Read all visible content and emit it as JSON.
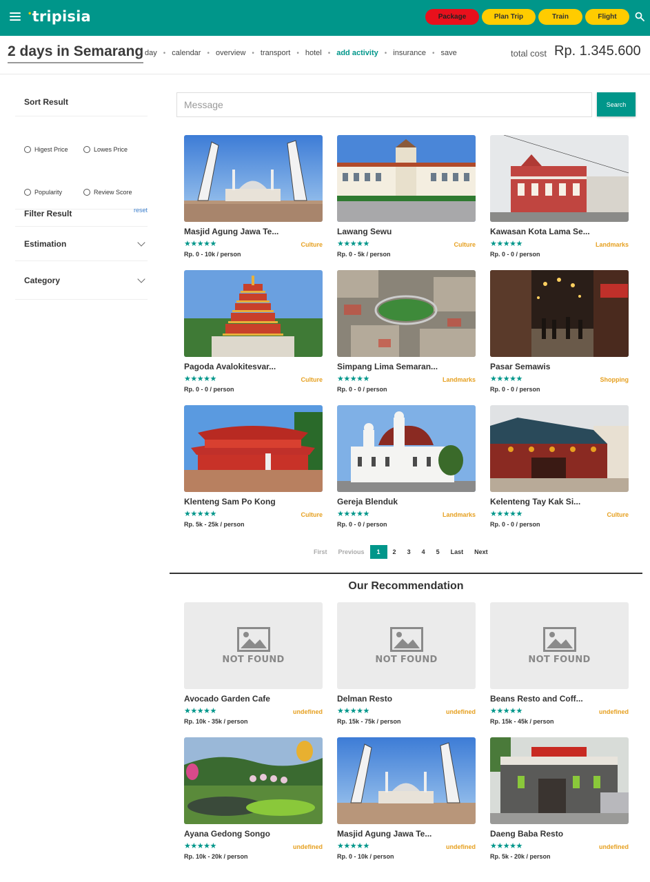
{
  "app": {
    "logo": "tripisia"
  },
  "topnav": {
    "buttons": [
      "Package",
      "Plan Trip",
      "Train",
      "Flight"
    ]
  },
  "trip": {
    "title": "2 days in Semarang",
    "nav": [
      "day",
      "calendar",
      "overview",
      "transport",
      "hotel",
      "add activity",
      "insurance",
      "save"
    ],
    "active_nav": "add activity",
    "total_label": "total cost",
    "total_value": "Rp. 1.345.600"
  },
  "sidebar": {
    "sort_title": "Sort Result",
    "sort_options": [
      "Higest Price",
      "Lowes Price",
      "Popularity",
      "Review Score"
    ],
    "filter_title": "Filter Result",
    "reset": "reset",
    "estimation": "Estimation",
    "category": "Category"
  },
  "search": {
    "placeholder": "Message",
    "button": "Search"
  },
  "activities": [
    {
      "name": "Masjid Agung Jawa Te...",
      "category": "Culture",
      "price": "Rp. 0 - 10k / person",
      "stars": "★★★★★"
    },
    {
      "name": "Lawang Sewu",
      "category": "Culture",
      "price": "Rp. 0 - 5k / person",
      "stars": "★★★★★"
    },
    {
      "name": "Kawasan Kota Lama Se...",
      "category": "Landmarks",
      "price": "Rp. 0 - 0 / person",
      "stars": "★★★★★"
    },
    {
      "name": "Pagoda Avalokitesvar...",
      "category": "Culture",
      "price": "Rp. 0 - 0 / person",
      "stars": "★★★★★"
    },
    {
      "name": "Simpang Lima Semaran...",
      "category": "Landmarks",
      "price": "Rp. 0 - 0 / person",
      "stars": "★★★★★"
    },
    {
      "name": "Pasar Semawis",
      "category": "Shopping",
      "price": "Rp. 0 - 0 / person",
      "stars": "★★★★★"
    },
    {
      "name": "Klenteng Sam Po Kong",
      "category": "Culture",
      "price": "Rp. 5k - 25k / person",
      "stars": "★★★★★"
    },
    {
      "name": "Gereja Blenduk",
      "category": "Landmarks",
      "price": "Rp. 0 - 0 / person",
      "stars": "★★★★★"
    },
    {
      "name": "Kelenteng Tay Kak Si...",
      "category": "Culture",
      "price": "Rp. 0 - 0 / person",
      "stars": "★★★★★"
    }
  ],
  "pagination": {
    "first": "First",
    "previous": "Previous",
    "pages": [
      "1",
      "2",
      "3",
      "4",
      "5"
    ],
    "current": "1",
    "last": "Last",
    "next": "Next"
  },
  "recommendation": {
    "title": "Our Recommendation",
    "not_found_text": "NOT FOUND",
    "items": [
      {
        "name": "Avocado Garden Cafe",
        "category": "undefined",
        "price": "Rp. 10k - 35k / person",
        "stars": "★★★★★"
      },
      {
        "name": "Delman Resto",
        "category": "undefined",
        "price": "Rp. 15k - 75k / person",
        "stars": "★★★★★"
      },
      {
        "name": "Beans Resto and Coff...",
        "category": "undefined",
        "price": "Rp. 15k - 45k / person",
        "stars": "★★★★★"
      },
      {
        "name": "Ayana Gedong Songo",
        "category": "undefined",
        "price": "Rp. 10k - 20k / person",
        "stars": "★★★★★"
      },
      {
        "name": "Masjid Agung Jawa Te...",
        "category": "undefined",
        "price": "Rp. 0 - 10k / person",
        "stars": "★★★★★"
      },
      {
        "name": "Daeng Baba Resto",
        "category": "undefined",
        "price": "Rp. 5k - 20k / person",
        "stars": "★★★★★"
      }
    ]
  },
  "colors": {
    "primary": "#00968a",
    "accent": "#ffcc00",
    "package": "#e8101c",
    "category": "#e6a020"
  }
}
